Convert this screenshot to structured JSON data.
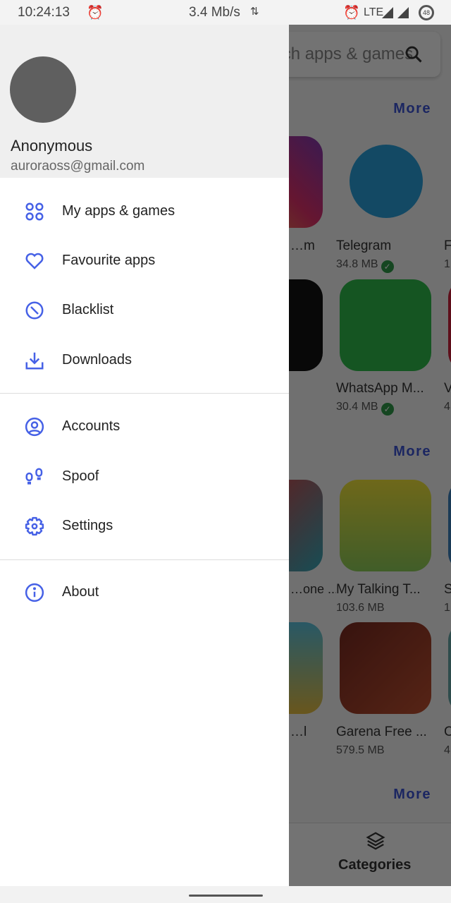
{
  "status_bar": {
    "time": "10:24:13",
    "speed": "3.4 Mb/s",
    "network": "LTE",
    "battery": "48"
  },
  "background_app": {
    "search_placeholder": "Search apps & games",
    "more_label": "More",
    "apps": [
      {
        "name": "…m",
        "size": ""
      },
      {
        "name": "Telegram",
        "size": "34.8 MB",
        "installed": true
      },
      {
        "name": "F",
        "size": "1"
      },
      {
        "name": "",
        "size": ""
      },
      {
        "name": "WhatsApp M...",
        "size": "30.4 MB",
        "installed": true
      },
      {
        "name": "V",
        "size": "4"
      },
      {
        "name": "…one ...",
        "size": ""
      },
      {
        "name": "My Talking T...",
        "size": "103.6 MB"
      },
      {
        "name": "S",
        "size": "1"
      },
      {
        "name": "…l",
        "size": ""
      },
      {
        "name": "Garena Free ...",
        "size": "579.5 MB"
      },
      {
        "name": "C",
        "size": "4"
      }
    ],
    "bottom_nav": {
      "categories": "Categories"
    }
  },
  "drawer": {
    "user_name": "Anonymous",
    "email": "auroraoss@gmail.com",
    "icon_color": "#4661e6",
    "items": [
      {
        "label": "My apps & games",
        "icon": "apps-icon"
      },
      {
        "label": "Favourite apps",
        "icon": "heart-icon"
      },
      {
        "label": "Blacklist",
        "icon": "block-icon"
      },
      {
        "label": "Downloads",
        "icon": "download-icon"
      },
      {
        "label": "Accounts",
        "icon": "account-icon"
      },
      {
        "label": "Spoof",
        "icon": "footprints-icon"
      },
      {
        "label": "Settings",
        "icon": "gear-icon"
      },
      {
        "label": "About",
        "icon": "info-icon"
      }
    ]
  }
}
